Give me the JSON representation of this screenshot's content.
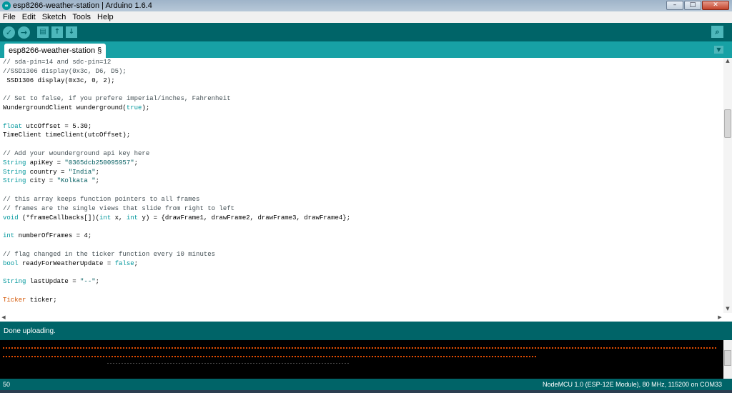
{
  "window": {
    "title": "esp8266-weather-station | Arduino 1.6.4",
    "controls": {
      "minimize": "–",
      "maximize": "□",
      "close": "✕"
    }
  },
  "menu": [
    "File",
    "Edit",
    "Sketch",
    "Tools",
    "Help"
  ],
  "toolbar": {
    "buttons": [
      {
        "name": "verify",
        "icon": "checkmark-icon",
        "glyph": "✓"
      },
      {
        "name": "upload",
        "icon": "arrow-right-icon",
        "glyph": "→"
      },
      {
        "name": "new",
        "icon": "new-file-icon",
        "glyph": "▤"
      },
      {
        "name": "open",
        "icon": "arrow-up-icon",
        "glyph": "↑"
      },
      {
        "name": "save",
        "icon": "arrow-down-icon",
        "glyph": "↓"
      }
    ],
    "serial_monitor_glyph": "⌕"
  },
  "tabs": {
    "active": "esp8266-weather-station §",
    "menu_glyph": "▼"
  },
  "code_lines": [
    "// sda-pin=14 and sdc-pin=12",
    "//SSD1306 display(0x3c, D6, D5);",
    " SSD1306 display(0x3c, 0, 2);",
    "",
    "// Set to false, if you prefere imperial/inches, Fahrenheit",
    "WundergroundClient wunderground(true);",
    "",
    "float utcOffset = 5.30;",
    "TimeClient timeClient(utcOffset);",
    "",
    "// Add your wounderground api key here",
    "String apiKey = \"0365dcb250095957\";",
    "String country = \"India\";",
    "String city = \"Kolkata \";",
    "",
    "// this array keeps function pointers to all frames",
    "// frames are the single views that slide from right to left",
    "void (*frameCallbacks[])(int x, int y) = {drawFrame1, drawFrame2, drawFrame3, drawFrame4};",
    "",
    "int numberOfFrames = 4;",
    "",
    "// flag changed in the ticker function every 10 minutes",
    "bool readyForWeatherUpdate = false;",
    "",
    "String lastUpdate = \"--\";",
    "",
    "Ticker ticker;"
  ],
  "status": {
    "message": "Done uploading."
  },
  "footer": {
    "line_number": "50",
    "board": "NodeMCU 1.0 (ESP-12E Module), 80 MHz, 115200 on COM33"
  },
  "colors": {
    "toolbar": "#006468",
    "tabbar": "#17a1a5",
    "button": "#4db7bb",
    "keyword": "#00979c",
    "type": "#d35400",
    "comment": "#434f54",
    "console_progress": "#e34c00"
  }
}
